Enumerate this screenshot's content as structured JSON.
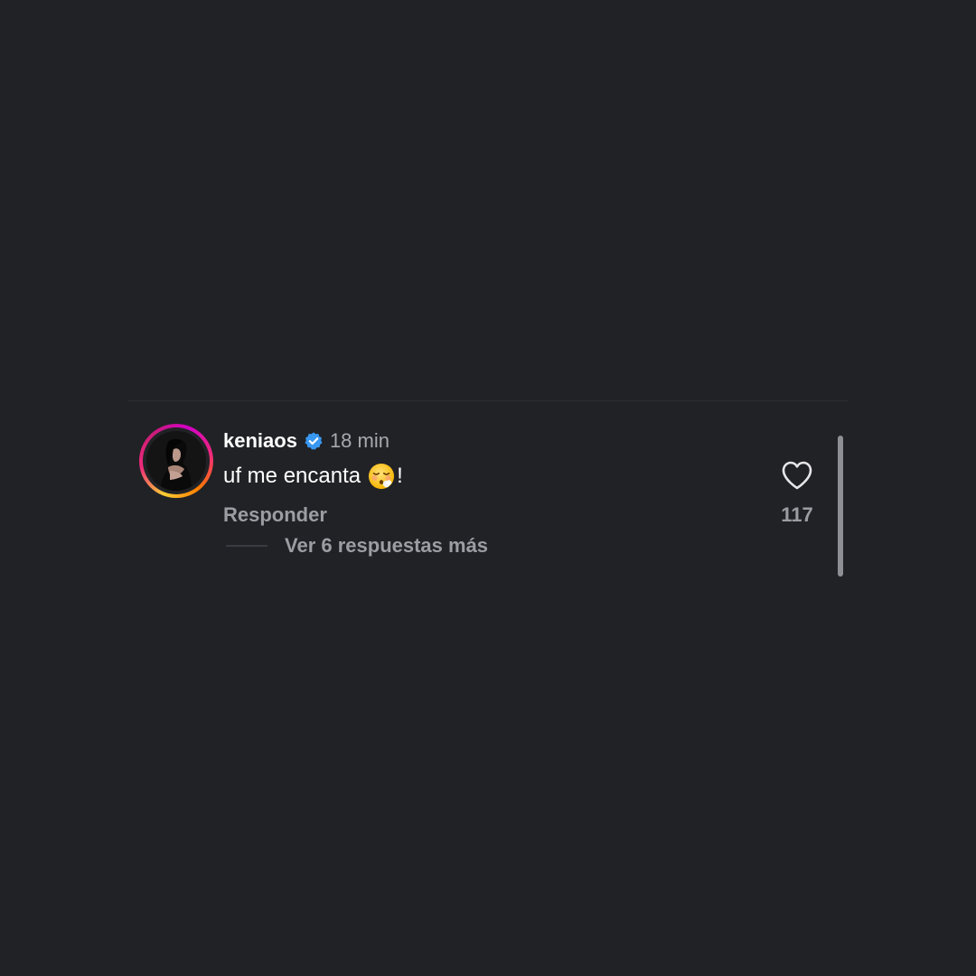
{
  "comment": {
    "username": "keniaos",
    "verified": true,
    "time": "18 min",
    "text": "uf me encanta",
    "emoji": "face-exhaling-emoji",
    "text_suffix": "!",
    "reply_label": "Responder",
    "view_replies_label": "Ver 6 respuestas más",
    "likes": "117"
  },
  "icons": {
    "verified": "verified-badge-icon",
    "like": "heart-icon"
  },
  "colors": {
    "background": "#212226",
    "verified_blue": "#3897f0",
    "secondary_text": "#9c9da3",
    "scrollbar": "#8e8f94"
  }
}
